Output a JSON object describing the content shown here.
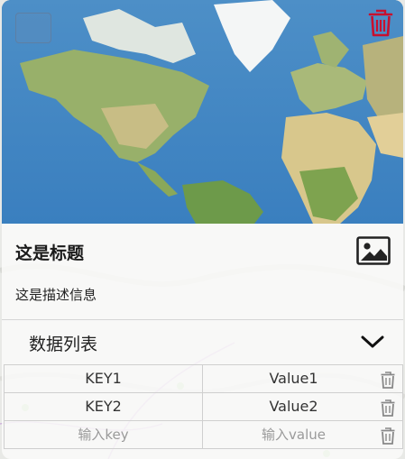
{
  "card": {
    "title": "这是标题",
    "description": "这是描述信息",
    "thumbnail_icon": "world-map",
    "select_checkbox_icon": "checkbox-icon",
    "delete_icon": "trash-icon",
    "image_icon": "image-icon"
  },
  "list": {
    "title": "数据列表",
    "toggle_icon": "chevron-down-icon",
    "rows": [
      {
        "key": "KEY1",
        "value": "Value1"
      },
      {
        "key": "KEY2",
        "value": "Value2"
      }
    ],
    "new_row": {
      "key_placeholder": "输入key",
      "value_placeholder": "输入value"
    }
  },
  "colors": {
    "delete_accent": "#c8102e",
    "row_delete": "#888888"
  }
}
